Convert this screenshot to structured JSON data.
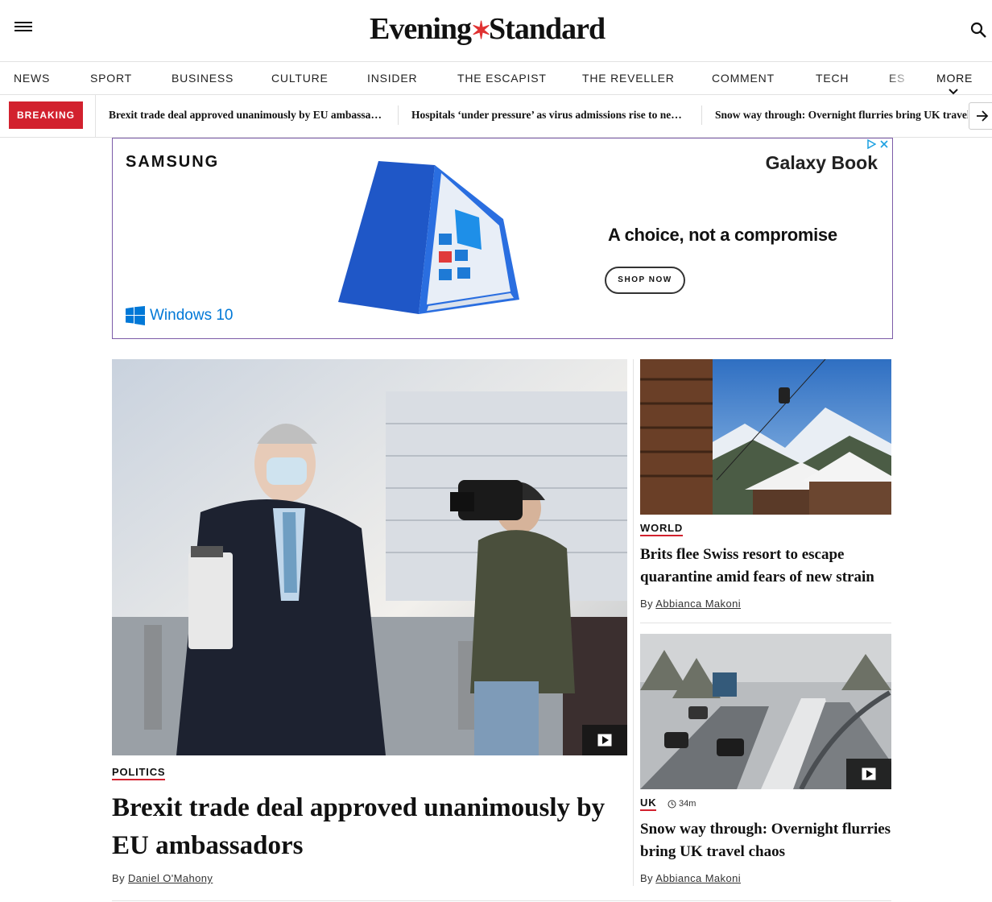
{
  "header": {
    "logo_left": "Evening",
    "logo_right": "Standard",
    "logo_mark": "✶"
  },
  "nav": {
    "items": [
      "NEWS",
      "SPORT",
      "BUSINESS",
      "CULTURE",
      "INSIDER",
      "THE ESCAPIST",
      "THE REVELLER",
      "COMMENT",
      "TECH",
      "ES"
    ],
    "more_label": "MORE"
  },
  "breaking": {
    "label": "BREAKING",
    "items": [
      "Brexit trade deal approved unanimously by EU ambassadors",
      "Hospitals ‘under pressure’ as virus admissions rise to new highs",
      "Snow way through: Overnight flurries bring UK travel chaos"
    ]
  },
  "ad": {
    "brand": "SAMSUNG",
    "product": "Galaxy Book",
    "tagline": "A choice, not a compromise",
    "cta": "SHOP NOW",
    "os_label": "Windows 10"
  },
  "main_story": {
    "category": "POLITICS",
    "title": "Brexit trade deal approved unanimously by EU ambassadors",
    "by": "By",
    "author": "Daniel O'Mahony"
  },
  "side_stories": [
    {
      "category": "WORLD",
      "title": "Brits flee Swiss resort to escape quarantine amid fears of new strain",
      "by": "By",
      "author": "Abbianca Makoni"
    },
    {
      "category": "UK",
      "time": "34m",
      "title": "Snow way through: Overnight flurries bring UK travel chaos",
      "by": "By",
      "author": "Abbianca Makoni"
    }
  ],
  "colors": {
    "accent_red": "#d2212e",
    "ad_border": "#7c5ca8",
    "windows_blue": "#0078d7"
  }
}
